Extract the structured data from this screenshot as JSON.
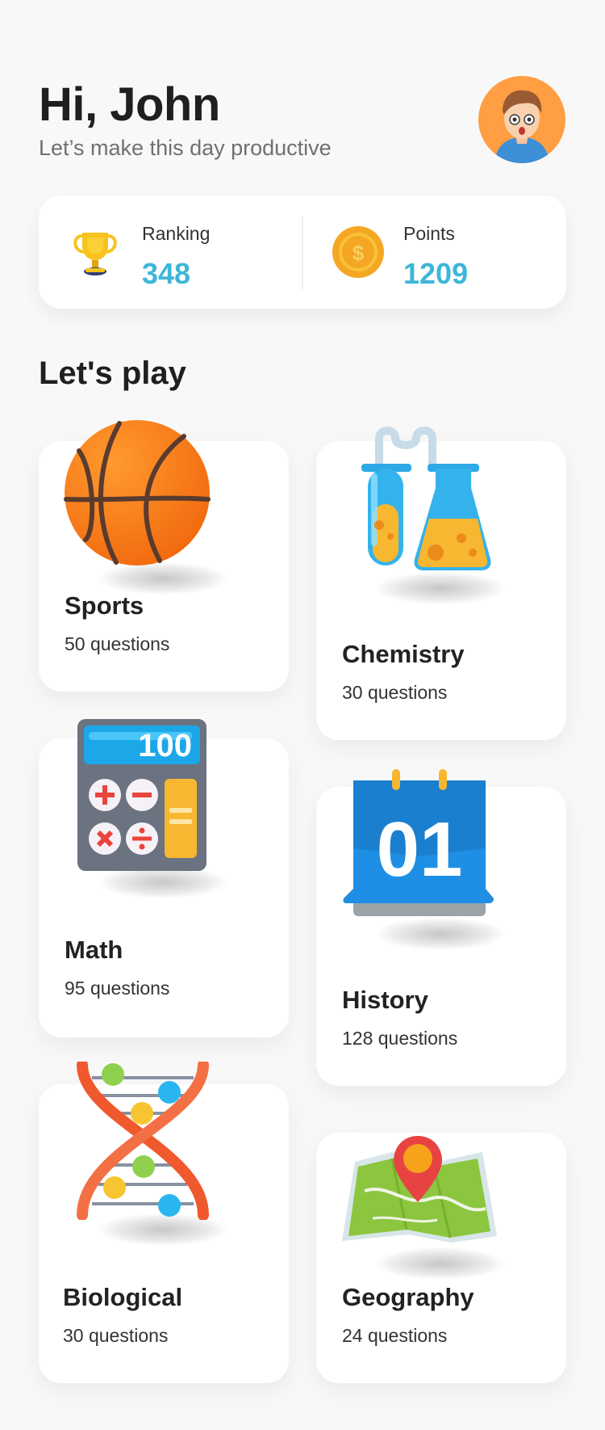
{
  "header": {
    "greeting": "Hi, John",
    "subtitle": "Let’s make this day productive"
  },
  "stats": [
    {
      "label": "Ranking",
      "value": "348",
      "icon": "trophy-icon"
    },
    {
      "label": "Points",
      "value": "1209",
      "icon": "coin-icon"
    }
  ],
  "section_title": "Let's play",
  "categories": [
    {
      "title": "Sports",
      "count": "50 questions",
      "icon": "basketball-icon"
    },
    {
      "title": "Chemistry",
      "count": "30 questions",
      "icon": "flasks-icon"
    },
    {
      "title": "Math",
      "count": "95 questions",
      "icon": "calculator-icon"
    },
    {
      "title": "History",
      "count": "128 questions",
      "icon": "calendar-icon"
    },
    {
      "title": "Biological",
      "count": "30 questions",
      "icon": "dna-icon"
    },
    {
      "title": "Geography",
      "count": "24 questions",
      "icon": "map-icon"
    }
  ],
  "illustration_text": {
    "calculator_display": "100",
    "calendar_day": "01"
  },
  "colors": {
    "background": "#f8f8f8",
    "accent": "#3db6d8",
    "avatar_bg": "#ff9e42"
  }
}
